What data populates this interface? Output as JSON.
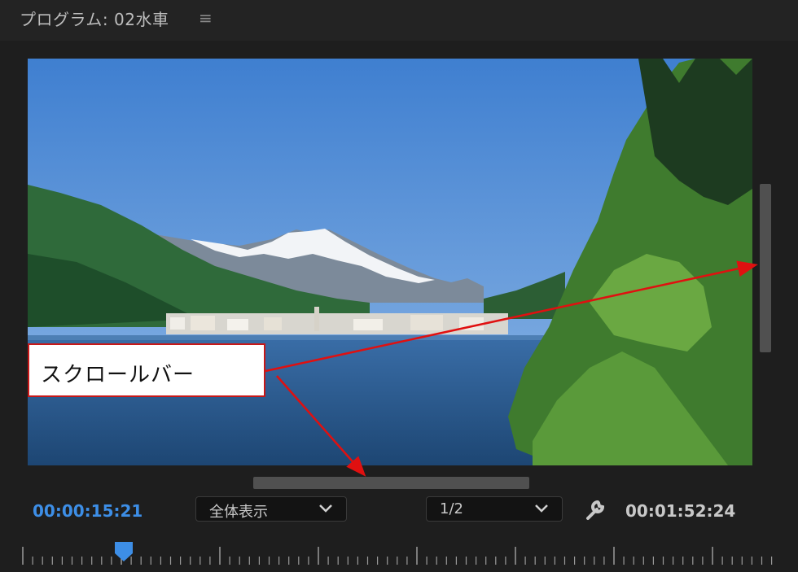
{
  "panel": {
    "title": "プログラム: 02水車",
    "menu_icon": "hamburger-icon"
  },
  "viewer": {
    "content": "mountain-lake-landscape"
  },
  "annotation": {
    "label": "スクロールバー",
    "border_color": "#c81818"
  },
  "controls": {
    "current_timecode": "00:00:15:21",
    "zoom_select": "全体表示",
    "resolution_select": "1/2",
    "settings_icon": "wrench-icon",
    "duration_timecode": "00:01:52:24"
  },
  "colors": {
    "accent": "#3d8ee6",
    "background": "#1e1e1e",
    "arrow": "#e01010"
  }
}
